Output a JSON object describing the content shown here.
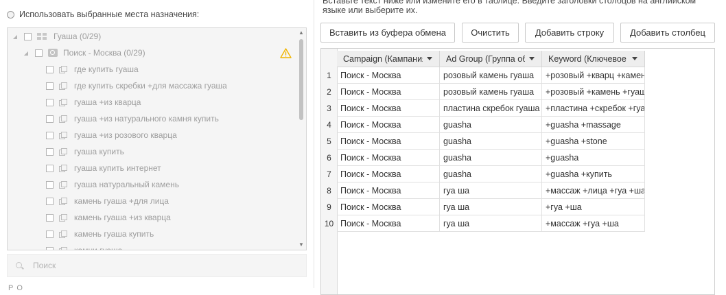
{
  "left": {
    "use_selected_label": "Использовать выбранные места назначения:",
    "tree": {
      "root": {
        "label": "Гуаша (0/29)"
      },
      "campaign": {
        "label": "Поиск - Москва (0/29)"
      },
      "keywords": [
        "где купить гуаша",
        "где купить скребки +для массажа гуаша",
        "гуаша +из кварца",
        "гуаша +из натурального камня купить",
        "гуаша +из розового кварца",
        "гуаша купить",
        "гуаша купить интернет",
        "гуаша натуральный камень",
        "камень гуаша +для лица",
        "камень гуаша +из кварца",
        "камень гуаша купить",
        "камни гуаша"
      ]
    },
    "search_placeholder": "Поиск",
    "bottom_cut_text": "Р          О"
  },
  "right": {
    "info_text": "Вставьте текст ниже или измените его в таблице. Введите заголовки столбцов на английском языке или выберите их.",
    "buttons": {
      "paste": "Вставить из буфера обмена",
      "clear": "Очистить",
      "add_row": "Добавить строку",
      "add_column": "Добавить столбец"
    },
    "table": {
      "headers": [
        "Campaign (Кампания)",
        "Ad Group (Группа объявлений)",
        "Keyword (Ключевое слово)"
      ],
      "rows": [
        [
          "Поиск - Москва",
          "розовый камень гуаша",
          "+розовый +кварц +камень"
        ],
        [
          "Поиск - Москва",
          "розовый камень гуаша",
          "+розовый +камень +гуаша"
        ],
        [
          "Поиск - Москва",
          "пластина скребок гуаша",
          "+пластина +скребок +гуаша"
        ],
        [
          "Поиск - Москва",
          "guasha",
          "+guasha +massage"
        ],
        [
          "Поиск - Москва",
          "guasha",
          "+guasha +stone"
        ],
        [
          "Поиск - Москва",
          "guasha",
          "+guasha"
        ],
        [
          "Поиск - Москва",
          "guasha",
          "+guasha +купить"
        ],
        [
          "Поиск - Москва",
          "гуа ша",
          "+массаж +лица +гуа +ша"
        ],
        [
          "Поиск - Москва",
          "гуа ша",
          "+гуа +ша"
        ],
        [
          "Поиск - Москва",
          "гуа ша",
          "+массаж +гуа +ша"
        ]
      ]
    }
  },
  "colors": {
    "warning": "#f0b400",
    "tree_text": "#9d9d9d",
    "tree_bg": "#f5f5f5"
  }
}
